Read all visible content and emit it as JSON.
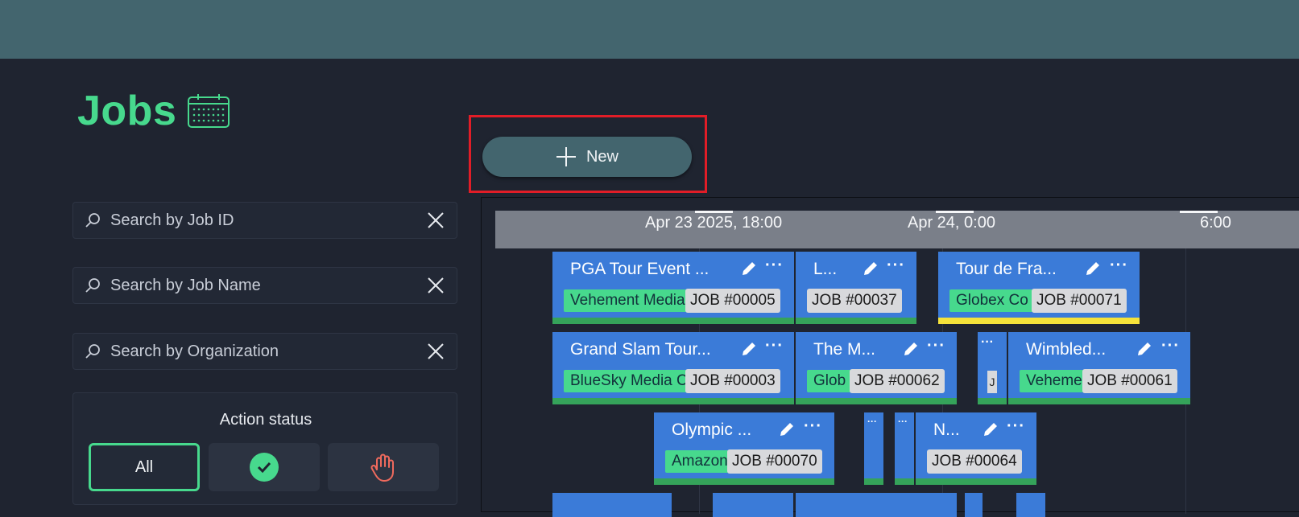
{
  "header": {
    "title": "Jobs",
    "calendar_icon": "calendar-icon"
  },
  "toolbar": {
    "new_label": "New"
  },
  "filters": {
    "job_id_placeholder": "Search by Job ID",
    "job_name_placeholder": "Search by Job Name",
    "organization_placeholder": "Search by Organization"
  },
  "action_status": {
    "title": "Action status",
    "options": [
      "All",
      "check-circle-icon",
      "hand-stop-icon"
    ],
    "selected": "All"
  },
  "timeline": {
    "ticks": [
      "Apr 23 2025, 18:00",
      "Apr 24, 0:00",
      "6:00"
    ],
    "jobs": [
      {
        "name": "PGA Tour Event ...",
        "org": "Vehement Media",
        "id": "JOB #00005",
        "status": "green"
      },
      {
        "name": "L...",
        "org": "",
        "id": "JOB #00037",
        "status": "green"
      },
      {
        "name": "Tour de Fra...",
        "org": "Globex Co",
        "id": "JOB #00071",
        "status": "yellow"
      },
      {
        "name": "Grand Slam Tour...",
        "org": "BlueSky Media C",
        "id": "JOB #00003",
        "status": "green"
      },
      {
        "name": "The M...",
        "org": "Glob",
        "id": "JOB #00062",
        "status": "green"
      },
      {
        "name": "Wimbled...",
        "org": "Veheme",
        "id": "JOB #00061",
        "status": "green"
      },
      {
        "name": "Olympic ...",
        "org": "Amazon",
        "id": "JOB #00070",
        "status": "green"
      },
      {
        "name": "N...",
        "org": "",
        "id": "JOB #00064",
        "status": "green"
      }
    ],
    "stub_text": {
      "dots": "···",
      "j": "J"
    }
  },
  "colors": {
    "accent": "#47d98d",
    "topbar": "#43656e",
    "job": "#3b7bd8",
    "highlight": "#e11d27"
  }
}
